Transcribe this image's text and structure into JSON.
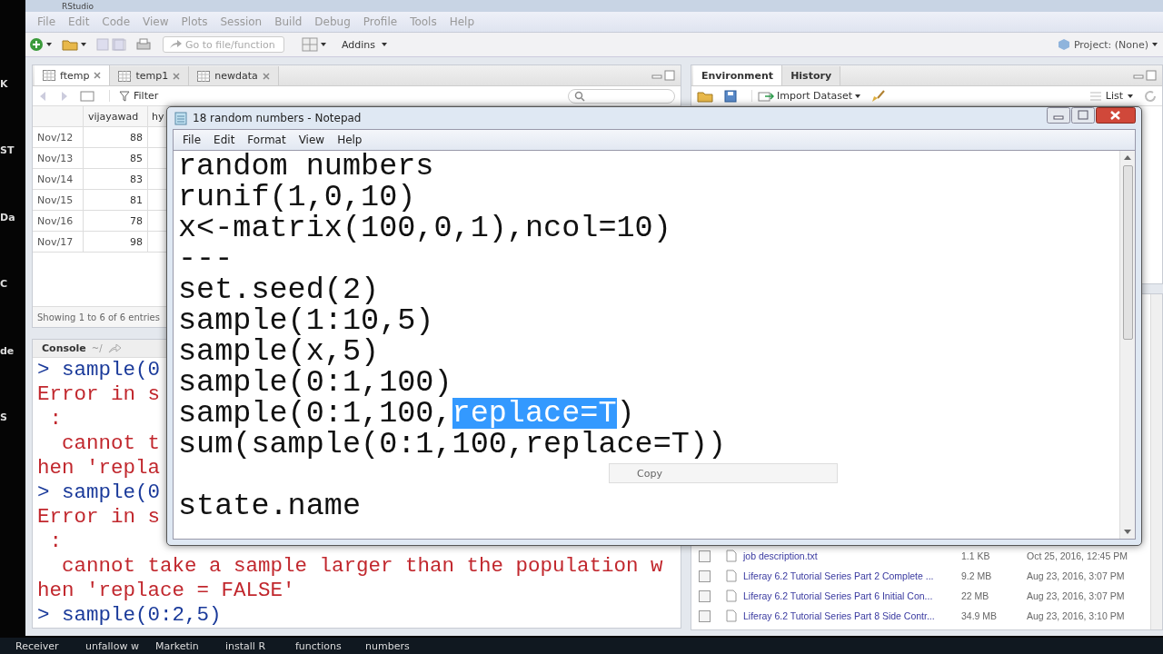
{
  "desktop": {
    "icon_labels": [
      "K",
      "ST",
      "Da",
      "C",
      "de",
      "S"
    ]
  },
  "rstudio": {
    "title": "RStudio",
    "menu": [
      "File",
      "Edit",
      "Code",
      "View",
      "Plots",
      "Session",
      "Build",
      "Debug",
      "Profile",
      "Tools",
      "Help"
    ],
    "toolbar": {
      "goto_placeholder": "Go to file/function",
      "addins": "Addins",
      "project": "Project: (None)"
    },
    "source_pane": {
      "tabs": [
        {
          "label": "ftemp",
          "selected": true
        },
        {
          "label": "temp1",
          "selected": false
        },
        {
          "label": "newdata",
          "selected": false
        }
      ],
      "filter": "Filter",
      "table": {
        "columns": [
          "vijayawad",
          "hy"
        ],
        "rows": [
          {
            "label": "Nov/12",
            "value": "88"
          },
          {
            "label": "Nov/13",
            "value": "85"
          },
          {
            "label": "Nov/14",
            "value": "83"
          },
          {
            "label": "Nov/15",
            "value": "81"
          },
          {
            "label": "Nov/16",
            "value": "78"
          },
          {
            "label": "Nov/17",
            "value": "98"
          }
        ]
      },
      "footer": "Showing 1 to 6 of 6 entries"
    },
    "console": {
      "title": "Console",
      "path": "~/",
      "lines": [
        {
          "kind": "input",
          "text": "> sample(0"
        },
        {
          "kind": "error",
          "text": "Error in s"
        },
        {
          "kind": "error",
          "text": " :"
        },
        {
          "kind": "error",
          "text": "  cannot t"
        },
        {
          "kind": "error",
          "text": "hen 'repla"
        },
        {
          "kind": "input",
          "text": "> sample(0"
        },
        {
          "kind": "error",
          "text": "Error in s"
        },
        {
          "kind": "error",
          "text": " :"
        },
        {
          "kind": "error",
          "text": "  cannot take a sample larger than the population w"
        },
        {
          "kind": "error",
          "text": "hen 'replace = FALSE'"
        },
        {
          "kind": "input",
          "text": "> sample(0:2,5)"
        }
      ]
    },
    "environment": {
      "tabs": [
        {
          "label": "Environment",
          "selected": true
        },
        {
          "label": "History",
          "selected": false
        }
      ],
      "import": "Import Dataset",
      "view": "List"
    },
    "files": {
      "rows": [
        {
          "name": "job description.txt",
          "size": "1.1 KB",
          "modified": "Oct 25, 2016, 12:45 PM",
          "checked": false
        },
        {
          "name": "Liferay 6.2 Tutorial Series Part 2 Complete ...",
          "size": "9.2 MB",
          "modified": "Aug 23, 2016, 3:07 PM",
          "checked": false
        },
        {
          "name": "Liferay 6.2 Tutorial Series Part 6 Initial Con...",
          "size": "22 MB",
          "modified": "Aug 23, 2016, 3:07 PM",
          "checked": false
        },
        {
          "name": "Liferay 6.2 Tutorial Series Part 8 Side Contr...",
          "size": "34.9 MB",
          "modified": "Aug 23, 2016, 3:10 PM",
          "checked": false
        }
      ]
    }
  },
  "notepad": {
    "title": "18 random numbers - Notepad",
    "menu": [
      "File",
      "Edit",
      "Format",
      "View",
      "Help"
    ],
    "lines": [
      {
        "segments": [
          {
            "text": "random numbers",
            "selected": false
          }
        ]
      },
      {
        "segments": [
          {
            "text": "runif(1,0,10)",
            "selected": false
          }
        ]
      },
      {
        "segments": [
          {
            "text": "x<-matrix(100,0,1),ncol=10)",
            "selected": false
          }
        ]
      },
      {
        "segments": [
          {
            "text": "---",
            "selected": false
          }
        ]
      },
      {
        "segments": [
          {
            "text": "set.seed(2)",
            "selected": false
          }
        ]
      },
      {
        "segments": [
          {
            "text": "sample(1:10,5)",
            "selected": false
          }
        ]
      },
      {
        "segments": [
          {
            "text": "sample(x,5)",
            "selected": false
          }
        ]
      },
      {
        "segments": [
          {
            "text": "sample(0:1,100)",
            "selected": false
          }
        ]
      },
      {
        "segments": [
          {
            "text": "sample(0:1,100,",
            "selected": false
          },
          {
            "text": "replace=T",
            "selected": true
          },
          {
            "text": ")",
            "selected": false
          }
        ]
      },
      {
        "segments": [
          {
            "text": "sum(sample(0:1,100,replace=T))",
            "selected": false
          }
        ]
      },
      {
        "segments": [
          {
            "text": "state.name",
            "selected": false
          }
        ],
        "blank_before": true
      }
    ],
    "context_menu": [
      "Copy"
    ]
  },
  "taskbar": {
    "items": [
      "Receiver",
      "unfallow w",
      "Marketin",
      "install R",
      "functions",
      "numbers"
    ]
  }
}
